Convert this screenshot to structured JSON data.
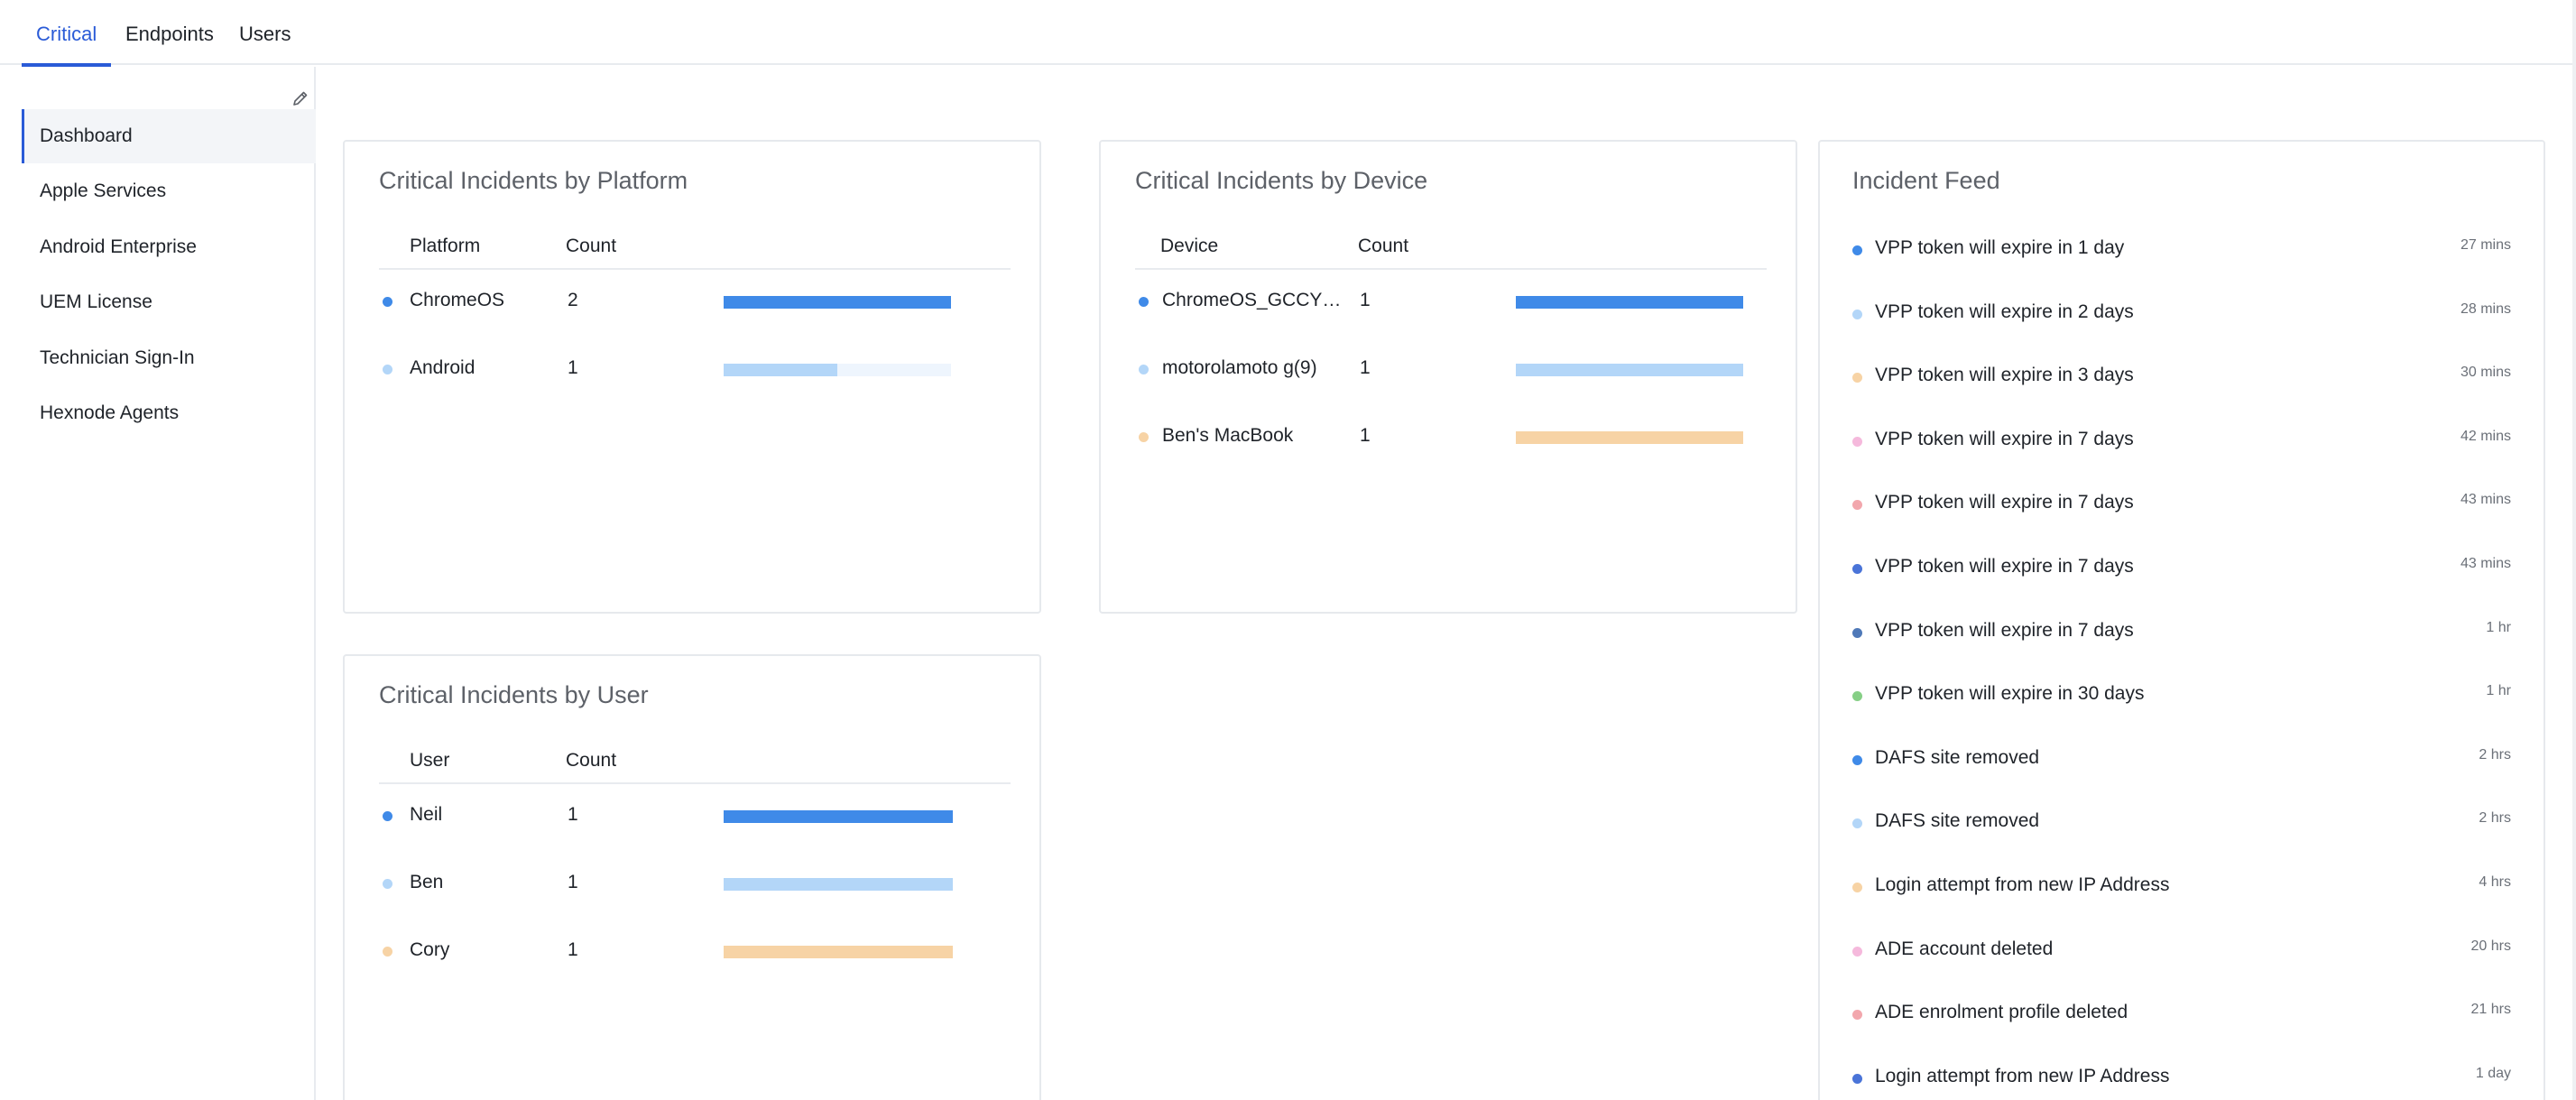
{
  "tabs": [
    {
      "label": "Critical",
      "active": true
    },
    {
      "label": "Endpoints",
      "active": false
    },
    {
      "label": "Users",
      "active": false
    }
  ],
  "sidebar": {
    "edit_icon": "pencil-icon",
    "items": [
      {
        "label": "Dashboard",
        "active": true
      },
      {
        "label": "Apple Services"
      },
      {
        "label": "Android Enterprise"
      },
      {
        "label": "UEM License"
      },
      {
        "label": "Technician Sign-In"
      },
      {
        "label": "Hexnode Agents"
      }
    ]
  },
  "colors": {
    "accent": "#2a5bd7",
    "series": [
      "#3f8ae8",
      "#b3d6f8",
      "#f7d3a5",
      "#f5b9dc",
      "#f2a7ad",
      "#4a74d8",
      "#4f79b8",
      "#86cf86"
    ]
  },
  "platform_card": {
    "title": "Critical Incidents by Platform",
    "headers": [
      "Platform",
      "Count"
    ],
    "rows": [
      {
        "label": "ChromeOS",
        "count": "2",
        "fraction": 1.0,
        "color": "#3f8ae8"
      },
      {
        "label": "Android",
        "count": "1",
        "fraction": 0.5,
        "color": "#b3d6f8",
        "track": "#eef5fd"
      }
    ]
  },
  "device_card": {
    "title": "Critical Incidents by Device",
    "headers": [
      "Device",
      "Count"
    ],
    "rows": [
      {
        "label": "ChromeOS_GCCYL…",
        "count": "1",
        "fraction": 1.0,
        "color": "#3f8ae8"
      },
      {
        "label": "motorolamoto g(9)",
        "count": "1",
        "fraction": 1.0,
        "color": "#b3d6f8"
      },
      {
        "label": "Ben's MacBook",
        "count": "1",
        "fraction": 1.0,
        "color": "#f7d3a5"
      }
    ]
  },
  "user_card": {
    "title": "Critical Incidents by User",
    "headers": [
      "User",
      "Count"
    ],
    "rows": [
      {
        "label": "Neil",
        "count": "1",
        "fraction": 1.0,
        "color": "#3f8ae8"
      },
      {
        "label": "Ben",
        "count": "1",
        "fraction": 1.0,
        "color": "#b3d6f8"
      },
      {
        "label": "Cory",
        "count": "1",
        "fraction": 1.0,
        "color": "#f7d3a5"
      }
    ]
  },
  "feed": {
    "title": "Incident Feed",
    "items": [
      {
        "text": "VPP token will expire in 1 day",
        "time": "27 mins",
        "color": "#3f8ae8"
      },
      {
        "text": "VPP token will expire in 2 days",
        "time": "28 mins",
        "color": "#b3d6f8"
      },
      {
        "text": "VPP token will expire in 3 days",
        "time": "30 mins",
        "color": "#f7d3a5"
      },
      {
        "text": "VPP token will expire in 7 days",
        "time": "42 mins",
        "color": "#f5b9dc"
      },
      {
        "text": "VPP token will expire in 7 days",
        "time": "43 mins",
        "color": "#f2a7ad"
      },
      {
        "text": "VPP token will expire in 7 days",
        "time": "43 mins",
        "color": "#4a74d8"
      },
      {
        "text": "VPP token will expire in 7 days",
        "time": "1 hr",
        "color": "#4f79b8"
      },
      {
        "text": "VPP token will expire in 30 days",
        "time": "1 hr",
        "color": "#86cf86"
      },
      {
        "text": "DAFS site removed",
        "time": "2 hrs",
        "color": "#3f8ae8"
      },
      {
        "text": "DAFS site removed",
        "time": "2 hrs",
        "color": "#b3d6f8"
      },
      {
        "text": "Login attempt from new IP Address",
        "time": "4 hrs",
        "color": "#f7d3a5"
      },
      {
        "text": "ADE account deleted",
        "time": "20 hrs",
        "color": "#f5b9dc"
      },
      {
        "text": "ADE enrolment profile deleted",
        "time": "21 hrs",
        "color": "#f2a7ad"
      },
      {
        "text": "Login attempt from new IP Address",
        "time": "1 day",
        "color": "#4a74d8"
      }
    ]
  }
}
